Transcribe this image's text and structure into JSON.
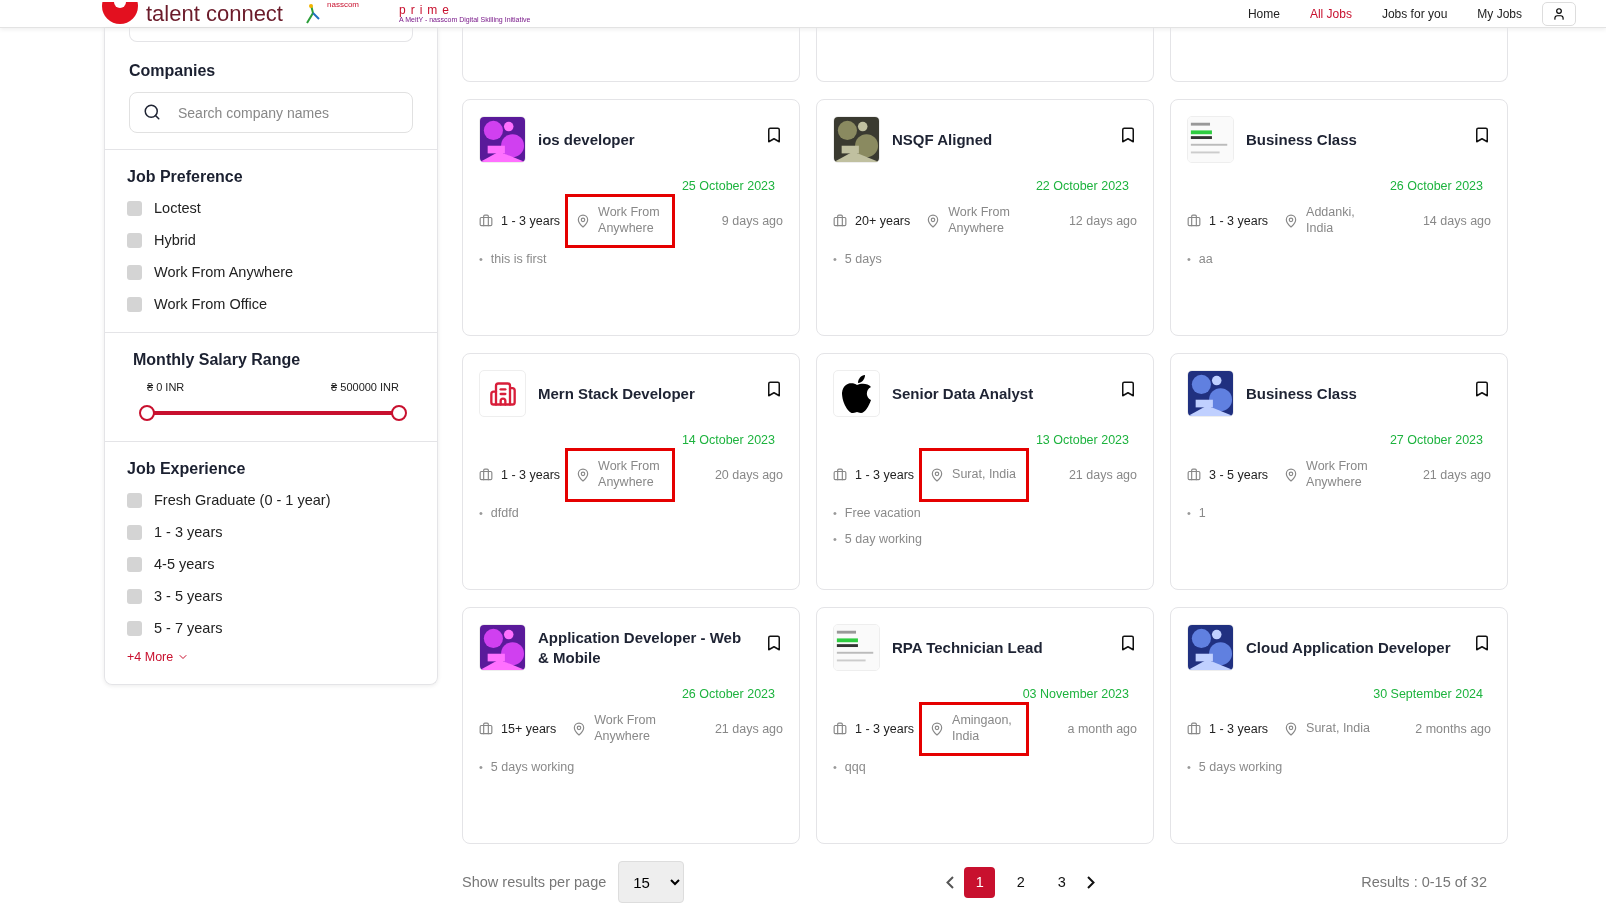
{
  "header": {
    "brand": "talent connect",
    "partner": "nasscom",
    "prime": "prime",
    "prime_tagline": "A MeitY - nasscom Digital Skilling Initiative",
    "nav": [
      {
        "label": "Home",
        "selected": false
      },
      {
        "label": "All Jobs",
        "selected": true
      },
      {
        "label": "Jobs for you",
        "selected": false
      },
      {
        "label": "My Jobs",
        "selected": false
      }
    ]
  },
  "sidebar": {
    "companies": {
      "title": "Companies",
      "placeholder": "Search company names"
    },
    "job_preference": {
      "title": "Job Preference",
      "options": [
        {
          "label": "Loctest",
          "checked": false
        },
        {
          "label": "Hybrid",
          "checked": false
        },
        {
          "label": "Work From Anywhere",
          "checked": false
        },
        {
          "label": "Work From Office",
          "checked": false
        }
      ]
    },
    "salary": {
      "title": "Monthly Salary Range",
      "min_label": "₴ 0 INR",
      "max_label": "₴ 500000 INR",
      "thumbs": [
        {
          "level": 0
        },
        {
          "level": 1
        }
      ]
    },
    "job_experience": {
      "title": "Job Experience",
      "options": [
        {
          "label": "Fresh Graduate (0 - 1 year)",
          "checked": false
        },
        {
          "label": "1 - 3 years",
          "checked": false
        },
        {
          "label": "4-5 years",
          "checked": false
        },
        {
          "label": "3 - 5 years",
          "checked": false
        },
        {
          "label": "5 - 7 years",
          "checked": false
        }
      ],
      "more": "+4 More"
    }
  },
  "perk_marker": "•",
  "jobs": [
    {
      "title": "ios developer",
      "kind": "picture",
      "date": "25 October 2023",
      "experience": "1 - 3 years",
      "location": "Work From Anywhere",
      "highlighted": true,
      "posted": "9 days ago",
      "perks": [
        "this is first"
      ]
    },
    {
      "title": "NSQF Aligned",
      "kind": "picture",
      "date": "22 October 2023",
      "experience": "20+ years",
      "location": "Work From Anywhere",
      "highlighted": false,
      "posted": "12 days ago",
      "perks": [
        "5 days"
      ]
    },
    {
      "title": "Business Class",
      "kind": "screen",
      "date": "26 October 2023",
      "experience": "1 - 3 years",
      "location": "Addanki, India",
      "highlighted": false,
      "posted": "14 days ago",
      "perks": [
        "aa"
      ]
    },
    {
      "title": "Mern Stack Developer",
      "kind": "building",
      "date": "14 October 2023",
      "experience": "1 - 3 years",
      "location": "Work From Anywhere",
      "highlighted": true,
      "posted": "20 days ago",
      "perks": [
        "dfdfd"
      ]
    },
    {
      "title": "Senior Data Analyst",
      "kind": "fruit",
      "date": "13 October 2023",
      "experience": "1 - 3 years",
      "location": "Surat, India",
      "highlighted": true,
      "posted": "21 days ago",
      "perks": [
        "Free vacation",
        "5 day working"
      ]
    },
    {
      "title": "Business Class",
      "kind": "picture",
      "date": "27 October 2023",
      "experience": "3 - 5 years",
      "location": "Work From Anywhere",
      "highlighted": false,
      "posted": "21 days ago",
      "perks": [
        "1"
      ]
    },
    {
      "title": "Application Developer - Web & Mobile",
      "kind": "picture",
      "date": "26 October 2023",
      "experience": "15+ years",
      "location": "Work From Anywhere",
      "highlighted": false,
      "posted": "21 days ago",
      "perks": [
        "5 days working"
      ]
    },
    {
      "title": "RPA Technician Lead",
      "kind": "screen",
      "date": "03 November 2023",
      "experience": "1 - 3 years",
      "location": "Amingaon, India",
      "highlighted": true,
      "posted": "a month ago",
      "perks": [
        "qqq"
      ]
    },
    {
      "title": "Cloud Application Developer",
      "kind": "picture",
      "date": "30 September 2024",
      "experience": "1 - 3 years",
      "location": "Surat, India",
      "highlighted": false,
      "posted": "2 months ago",
      "perks": [
        "5 days working"
      ]
    }
  ],
  "footer": {
    "per_page_label": "Show results per page",
    "per_page": "15",
    "pages": [
      {
        "label": "1",
        "selected": true
      },
      {
        "label": "2",
        "selected": false
      },
      {
        "label": "3",
        "selected": false
      }
    ],
    "results": "Results : 0-15 of 32"
  }
}
